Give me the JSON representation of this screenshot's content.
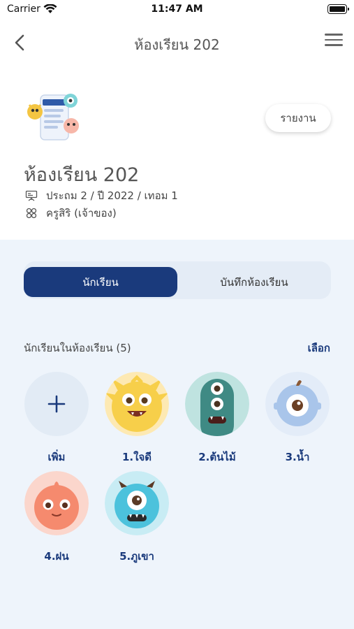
{
  "status_bar": {
    "carrier": "Carrier",
    "time": "11:47 AM"
  },
  "nav": {
    "title": "ห้องเรียน 202"
  },
  "classroom": {
    "report_label": "รายงาน",
    "name": "ห้องเรียน 202",
    "grade_info": "ประถม 2 / ปี 2022 / เทอม 1",
    "owner_info": "ครูสิริ (เจ้าของ)"
  },
  "tabs": {
    "students": "นักเรียน",
    "class_log": "บันทึกห้องเรียน"
  },
  "students_section": {
    "title": "นักเรียนในห้องเรียน (5)",
    "select_label": "เลือก",
    "add_label": "เพิ่ม",
    "students": [
      {
        "name": "1.ใจดี"
      },
      {
        "name": "2.ต้นไม้"
      },
      {
        "name": "3.น้ำ"
      },
      {
        "name": "4.ฝน"
      },
      {
        "name": "5.ภูเขา"
      }
    ]
  },
  "colors": {
    "primary": "#1a3a7c",
    "panel_bg": "#eef4fb"
  }
}
